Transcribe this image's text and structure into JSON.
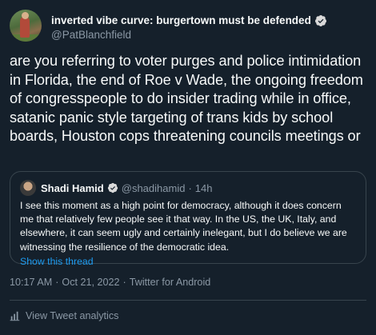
{
  "author": {
    "display_name": "inverted vibe curve: burgertown must be defended",
    "handle": "@PatBlanchfield",
    "verified": true
  },
  "tweet": {
    "text": "are you referring to voter purges and police intimidation in Florida, the end of Roe v Wade, the ongoing freedom of congresspeople to do insider trading while in office, satanic panic style targeting of trans kids by school boards, Houston cops threatening councils meetings or"
  },
  "quoted": {
    "name": "Shadi Hamid",
    "handle": "@shadihamid",
    "separator": "·",
    "time": "14h",
    "text": "I see this moment as a high point for democracy, although it does concern me that relatively few people see it that way. In the US, the UK, Italy, and elsewhere, it can seem ugly and certainly inelegant, but I do believe we are witnessing the resilience of the democratic idea.",
    "show_thread": "Show this thread"
  },
  "meta": {
    "time": "10:17 AM",
    "sep1": "·",
    "date": "Oct 21, 2022",
    "sep2": "·",
    "client": "Twitter for Android"
  },
  "analytics": {
    "label": "View Tweet analytics"
  },
  "colors": {
    "background": "#15202b",
    "text": "#f7f9f9",
    "secondary": "#8b98a5",
    "link": "#1d9bf0",
    "verified": "#d9d9d9",
    "border": "#38444d"
  }
}
